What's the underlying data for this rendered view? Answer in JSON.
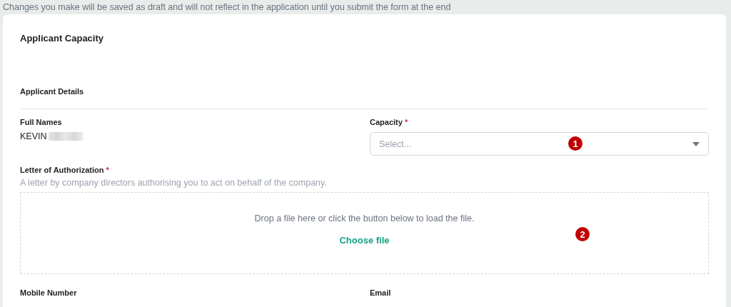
{
  "notice": "Changes you make will be saved as draft and will not reflect in the application until you submit the form at the end",
  "card": {
    "title": "Applicant Capacity",
    "section": "Applicant Details",
    "full_names": {
      "label": "Full Names",
      "value": "KEVIN"
    },
    "capacity": {
      "label": "Capacity",
      "required_mark": "*",
      "placeholder": "Select...",
      "marker": "1"
    },
    "letter": {
      "label": "Letter of Authorization",
      "required_mark": "*",
      "hint": "A letter by company directors authorising you to act on behalf of the company.",
      "drop_text": "Drop a file here or click the button below to load the file.",
      "button": "Choose file",
      "marker": "2"
    },
    "bottom_labels": [
      "Mobile Number",
      "Email"
    ]
  }
}
